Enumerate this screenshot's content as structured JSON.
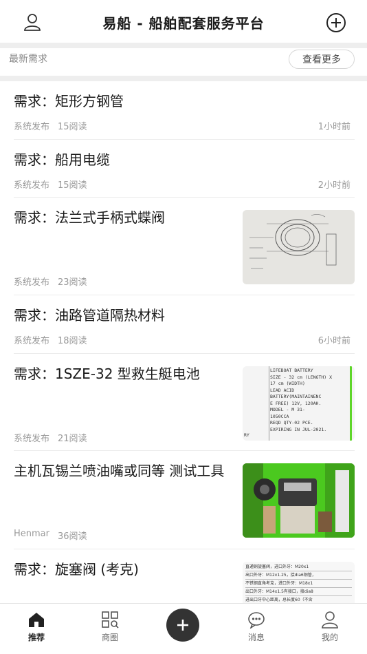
{
  "header": {
    "title": "易船 - 船舶配套服务平台",
    "user_icon": "user-icon",
    "add_icon": "plus-circle-icon"
  },
  "section": {
    "label": "最新需求",
    "more_label": "查看更多"
  },
  "items": [
    {
      "title": "需求：矩形方钢管",
      "author": "系统发布",
      "reads": "15阅读",
      "time": "1小时前",
      "thumb": ""
    },
    {
      "title": "需求：船用电缆",
      "author": "系统发布",
      "reads": "15阅读",
      "time": "2小时前",
      "thumb": ""
    },
    {
      "title": "需求：法兰式手柄式蝶阀",
      "author": "系统发布",
      "reads": "23阅读",
      "time": "",
      "thumb": "sketch"
    },
    {
      "title": "需求：油路管道隔热材料",
      "author": "系统发布",
      "reads": "18阅读",
      "time": "6小时前",
      "thumb": ""
    },
    {
      "title": "需求：1SZE-32 型救生艇电池",
      "author": "系统发布",
      "reads": "21阅读",
      "time": "",
      "thumb": "document",
      "thumb_text": [
        "LIFEBOAT BATTERY",
        "SIZE - 32 cm (LENGTH) X",
        "17 cm (WIDTH)",
        "LEAD ACID",
        "BATTERY(MAINTAINENC",
        "E FREE) 12V, 120AH.",
        "MODEL - M 31-",
        "1050CCA",
        "REQD QTY-02 PCE.",
        "EXPIRING IN JUL-2021.",
        "RY"
      ]
    },
    {
      "title": "主机瓦锡兰喷油嘴或同等 测试工具",
      "author": "Henmar",
      "reads": "36阅读",
      "time": "",
      "thumb": "photo"
    },
    {
      "title": "需求：旋塞阀 (考克)",
      "author": "",
      "reads": "",
      "time": "",
      "thumb": "table",
      "thumb_text": [
        "直通铜旋塞阀，进口外牙：M20x1",
        "出口外牙：M12x1.25，接dia6铜管，",
        "不锈钢直角考克，进口外牙：M18x1",
        "出口外牙：M14x1.5有接口，接dia8",
        "进出口牙中心距离，总长度60（不含"
      ]
    }
  ],
  "tabs": [
    {
      "label": "推荐",
      "icon": "home-icon",
      "active": true
    },
    {
      "label": "商圈",
      "icon": "grid-search-icon",
      "active": false
    },
    {
      "label": "",
      "icon": "plus-icon",
      "active": false
    },
    {
      "label": "消息",
      "icon": "chat-bubble-icon",
      "active": false
    },
    {
      "label": "我的",
      "icon": "person-icon",
      "active": false
    }
  ],
  "colors": {
    "accent": "#333333",
    "muted": "#999999",
    "divider": "#eeeeee",
    "green": "#5fd62a"
  }
}
